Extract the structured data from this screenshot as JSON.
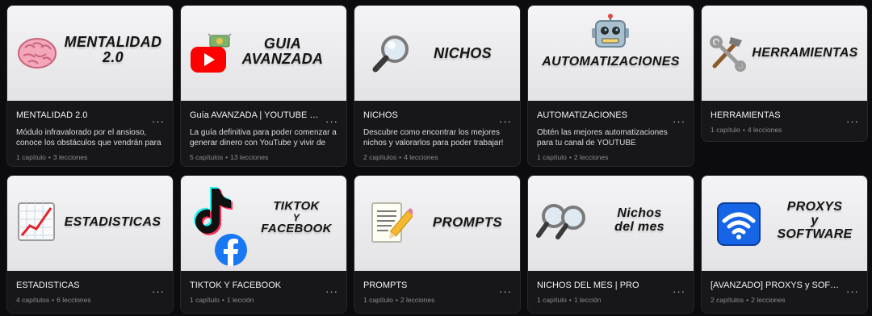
{
  "courses": [
    {
      "thumb_title": [
        "MENTALIDAD",
        "2.0"
      ],
      "title": "MENTALIDAD 2.0",
      "description": "Módulo infravalorado por el ansioso, conoce los obstáculos que vendrán para t...",
      "chapters": "1 capítulo",
      "lessons": "3 lecciones",
      "icon": "brain-icon"
    },
    {
      "thumb_title": [
        "GUIA",
        "AVANZADA"
      ],
      "title": "Guía AVANZADA | YOUTUBE FA...",
      "description": "La guía definitiva para poder comenzar a generar dinero con YouTube y vivir de ello",
      "chapters": "5 capítulos",
      "lessons": "13 lecciones",
      "icon": "youtube-icon"
    },
    {
      "thumb_title": [
        "NICHOS"
      ],
      "title": "NICHOS",
      "description": "Descubre como encontrar los mejores nichos y valorarlos para poder trabajar!",
      "chapters": "2 capítulos",
      "lessons": "4 lecciones",
      "icon": "magnifier-icon"
    },
    {
      "thumb_title": [
        "AUTOMATIZACIONES"
      ],
      "title": "AUTOMATIZACIONES",
      "description": "Obtén las mejores automatizaciones para tu canal de YOUTUBE",
      "chapters": "1 capítulo",
      "lessons": "2 lecciones",
      "icon": "robot-icon"
    },
    {
      "thumb_title": [
        "HERRAMIENTAS"
      ],
      "title": "HERRAMIENTAS",
      "description": "",
      "chapters": "1 capítulo",
      "lessons": "4 lecciones",
      "icon": "tools-icon"
    },
    {
      "thumb_title": [
        "ESTADISTICAS"
      ],
      "title": "ESTADISTICAS",
      "description": "",
      "chapters": "4 capítulos",
      "lessons": "6 lecciones",
      "icon": "chart-icon"
    },
    {
      "thumb_title": [
        "TIKTOK",
        "Y",
        "FACEBOOK"
      ],
      "title": "TIKTOK Y FACEBOOK",
      "description": "",
      "chapters": "1 capítulo",
      "lessons": "1 lección",
      "icon": "tiktok-facebook-icon"
    },
    {
      "thumb_title": [
        "PROMPTS"
      ],
      "title": "PROMPTS",
      "description": "",
      "chapters": "1 capítulo",
      "lessons": "2 lecciones",
      "icon": "memo-icon"
    },
    {
      "thumb_title": [
        "Nichos",
        "del mes"
      ],
      "title": "NICHOS DEL MES | PRO",
      "description": "",
      "chapters": "1 capítulo",
      "lessons": "1 lección",
      "icon": "double-magnifier-icon"
    },
    {
      "thumb_title": [
        "PROXYS",
        "y",
        "SOFTWARE"
      ],
      "title": "[AVANZADO] PROXYS y SOFTW...",
      "description": "",
      "chapters": "2 capítulos",
      "lessons": "2 lecciones",
      "icon": "wifi-icon"
    }
  ],
  "menu_glyph": "···",
  "colors": {
    "background": "#0c0c0e",
    "card": "#17171a",
    "youtube_red": "#ff0000",
    "facebook_blue": "#1877f2",
    "wifi_blue": "#1565e6"
  }
}
